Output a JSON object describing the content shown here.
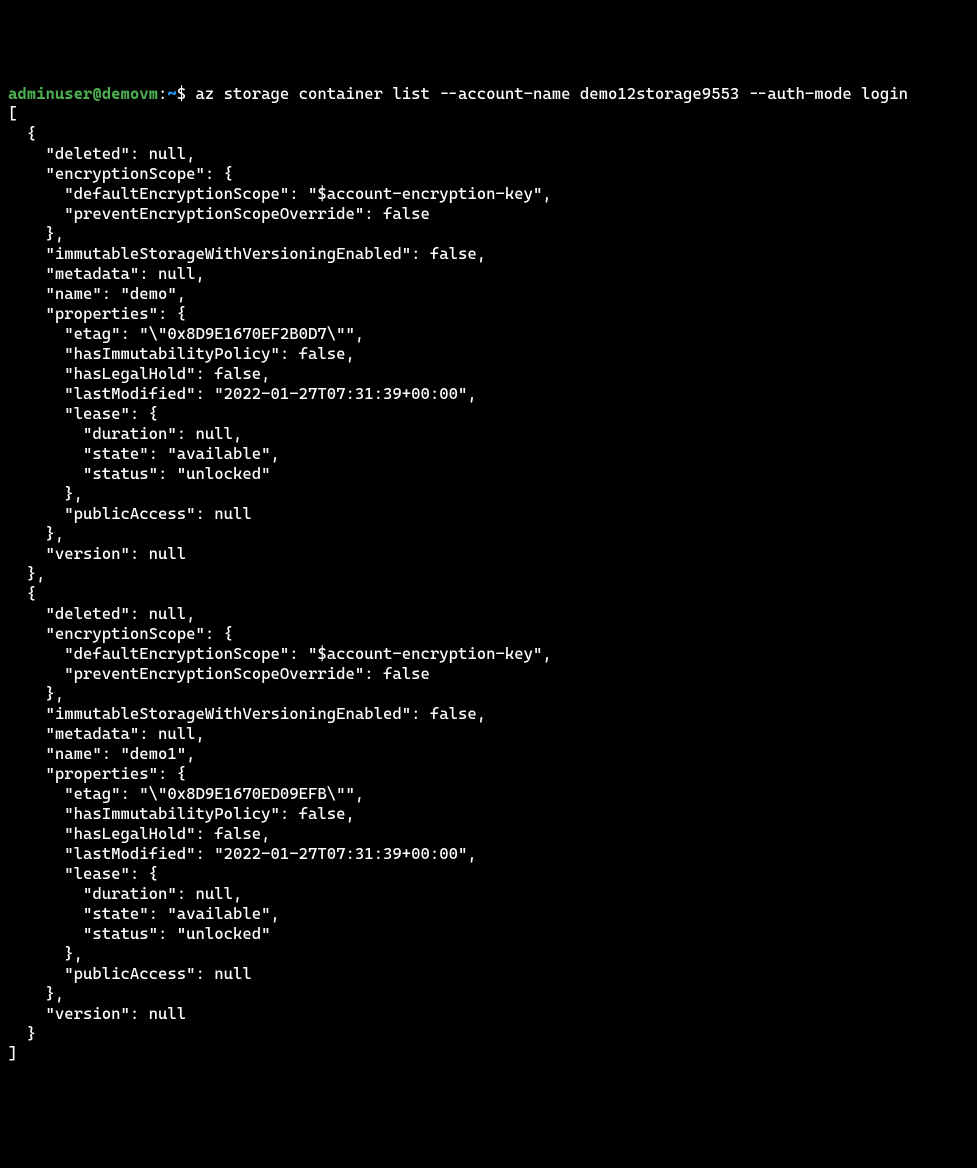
{
  "prompt": {
    "user": "adminuser",
    "at": "@",
    "host": "demovm",
    "colon": ":",
    "path": "~",
    "dollar": "$"
  },
  "command": " az storage container list --account-name demo12storage9553 --auth-mode login",
  "output": "[\n  {\n    \"deleted\": null,\n    \"encryptionScope\": {\n      \"defaultEncryptionScope\": \"$account-encryption-key\",\n      \"preventEncryptionScopeOverride\": false\n    },\n    \"immutableStorageWithVersioningEnabled\": false,\n    \"metadata\": null,\n    \"name\": \"demo\",\n    \"properties\": {\n      \"etag\": \"\\\"0x8D9E1670EF2B0D7\\\"\",\n      \"hasImmutabilityPolicy\": false,\n      \"hasLegalHold\": false,\n      \"lastModified\": \"2022-01-27T07:31:39+00:00\",\n      \"lease\": {\n        \"duration\": null,\n        \"state\": \"available\",\n        \"status\": \"unlocked\"\n      },\n      \"publicAccess\": null\n    },\n    \"version\": null\n  },\n  {\n    \"deleted\": null,\n    \"encryptionScope\": {\n      \"defaultEncryptionScope\": \"$account-encryption-key\",\n      \"preventEncryptionScopeOverride\": false\n    },\n    \"immutableStorageWithVersioningEnabled\": false,\n    \"metadata\": null,\n    \"name\": \"demo1\",\n    \"properties\": {\n      \"etag\": \"\\\"0x8D9E1670ED09EFB\\\"\",\n      \"hasImmutabilityPolicy\": false,\n      \"hasLegalHold\": false,\n      \"lastModified\": \"2022-01-27T07:31:39+00:00\",\n      \"lease\": {\n        \"duration\": null,\n        \"state\": \"available\",\n        \"status\": \"unlocked\"\n      },\n      \"publicAccess\": null\n    },\n    \"version\": null\n  }\n]",
  "json_data": [
    {
      "deleted": null,
      "encryptionScope": {
        "defaultEncryptionScope": "$account-encryption-key",
        "preventEncryptionScopeOverride": false
      },
      "immutableStorageWithVersioningEnabled": false,
      "metadata": null,
      "name": "demo",
      "properties": {
        "etag": "\"0x8D9E1670EF2B0D7\"",
        "hasImmutabilityPolicy": false,
        "hasLegalHold": false,
        "lastModified": "2022-01-27T07:31:39+00:00",
        "lease": {
          "duration": null,
          "state": "available",
          "status": "unlocked"
        },
        "publicAccess": null
      },
      "version": null
    },
    {
      "deleted": null,
      "encryptionScope": {
        "defaultEncryptionScope": "$account-encryption-key",
        "preventEncryptionScopeOverride": false
      },
      "immutableStorageWithVersioningEnabled": false,
      "metadata": null,
      "name": "demo1",
      "properties": {
        "etag": "\"0x8D9E1670ED09EFB\"",
        "hasImmutabilityPolicy": false,
        "hasLegalHold": false,
        "lastModified": "2022-01-27T07:31:39+00:00",
        "lease": {
          "duration": null,
          "state": "available",
          "status": "unlocked"
        },
        "publicAccess": null
      },
      "version": null
    }
  ]
}
